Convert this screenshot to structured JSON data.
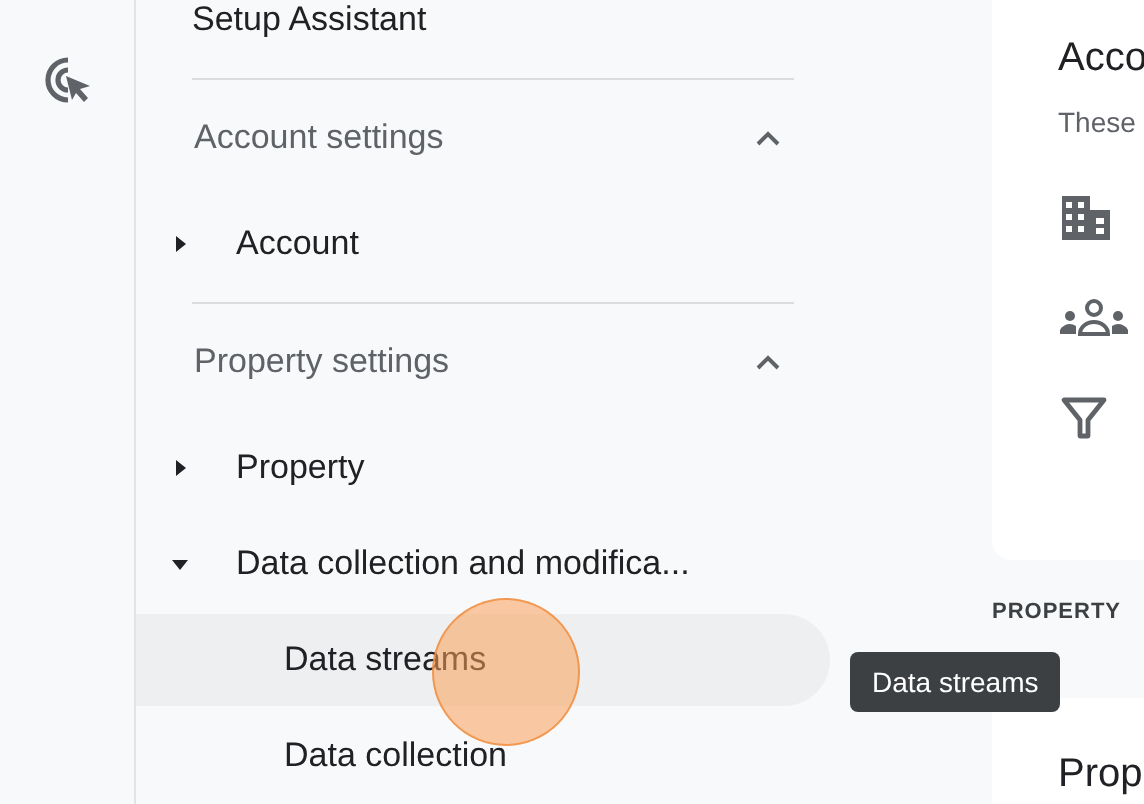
{
  "top_item": {
    "label": "Setup Assistant"
  },
  "sections": [
    {
      "title": "Account settings",
      "expanded": true,
      "items": [
        {
          "label": "Account",
          "expanded": false
        }
      ]
    },
    {
      "title": "Property settings",
      "expanded": true,
      "items": [
        {
          "label": "Property",
          "expanded": false
        },
        {
          "label": "Data collection and modifica...",
          "expanded": true,
          "children": [
            {
              "label": "Data streams",
              "selected": true
            },
            {
              "label": "Data collection",
              "selected": false
            }
          ]
        }
      ]
    }
  ],
  "tooltip": {
    "text": "Data streams"
  },
  "main": {
    "card_title": "Acco",
    "card_subtitle": "These",
    "section_label": "PROPERTY",
    "card2_title": "Prop"
  }
}
